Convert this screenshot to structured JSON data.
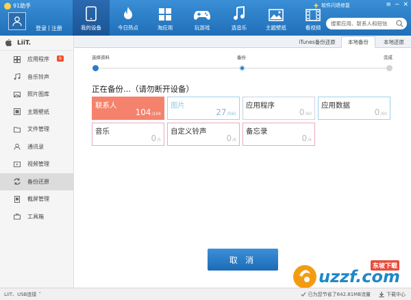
{
  "app": {
    "title": "91助手"
  },
  "header": {
    "login_label": "登录",
    "sep": "|",
    "register_label": "注册",
    "nav": [
      {
        "label": "我的设备",
        "icon": "phone-icon",
        "active": true
      },
      {
        "label": "今日热点",
        "icon": "flame-icon"
      },
      {
        "label": "淘应用",
        "icon": "apps-grid-icon"
      },
      {
        "label": "玩游戏",
        "icon": "gamepad-icon"
      },
      {
        "label": "选音乐",
        "icon": "music-note-icon"
      },
      {
        "label": "主题壁纸",
        "icon": "landscape-icon"
      },
      {
        "label": "看视频",
        "icon": "film-icon"
      }
    ],
    "sys_links": [
      "软件闪退修复"
    ],
    "search_placeholder": "搜索应用、联系人和短信"
  },
  "sidebar": {
    "device_name": "LiiT.",
    "items": [
      {
        "label": "应用程序",
        "icon": "apps-icon",
        "badge": "6"
      },
      {
        "label": "音乐铃声",
        "icon": "music-icon"
      },
      {
        "label": "照片图库",
        "icon": "photo-icon"
      },
      {
        "label": "主题壁纸",
        "icon": "theme-icon"
      },
      {
        "label": "文件管理",
        "icon": "folder-icon"
      },
      {
        "label": "通讯录",
        "icon": "contacts-icon"
      },
      {
        "label": "视频管理",
        "icon": "video-icon"
      },
      {
        "label": "备份还原",
        "icon": "backup-icon",
        "active": true
      },
      {
        "label": "截屏管理",
        "icon": "screenshot-icon"
      },
      {
        "label": "工具箱",
        "icon": "toolbox-icon"
      }
    ]
  },
  "tabs": [
    {
      "label": "iTunes备份还原"
    },
    {
      "label": "本地备份",
      "active": true
    },
    {
      "label": "本地还原"
    }
  ],
  "steps": [
    "选择资料",
    "备份",
    "完成"
  ],
  "status_text": "正在备份...（请勿断开设备）",
  "cards": [
    {
      "name": "联系人",
      "count": "104",
      "total": "/104",
      "state": "done"
    },
    {
      "name": "图片",
      "count": "27",
      "total": "/591",
      "state": "active"
    },
    {
      "name": "应用程序",
      "count": "0",
      "total": "/60",
      "state": "app"
    },
    {
      "name": "应用数据",
      "count": "0",
      "total": "/60",
      "state": "data"
    },
    {
      "name": "音乐",
      "count": "0",
      "total": "/5",
      "state": "pink"
    },
    {
      "name": "自定义铃声",
      "count": "0",
      "total": "/6",
      "state": "pink"
    },
    {
      "name": "备忘录",
      "count": "0",
      "total": "/4",
      "state": "pink"
    }
  ],
  "cancel_label": "取 消",
  "statusbar": {
    "connection": "LiiT、USB连接",
    "saved": "已为您节省了642.81MB流量",
    "download": "下载中心"
  },
  "watermark": {
    "brand": "uzzf.com",
    "tag": "东坡下载"
  },
  "colors": {
    "accent": "#1f6fb8",
    "done": "#f5826c",
    "active": "#9dd0ec"
  }
}
